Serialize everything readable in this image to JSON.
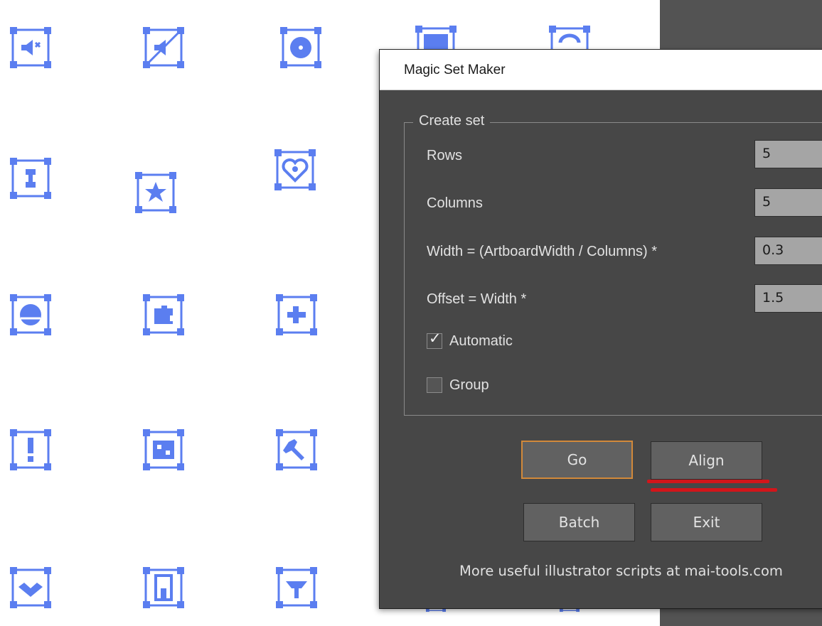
{
  "dialog": {
    "title": "Magic Set Maker",
    "group_title": "Create set",
    "fields": {
      "rows": {
        "label": "Rows",
        "value": "5"
      },
      "columns": {
        "label": "Columns",
        "value": "5"
      },
      "width": {
        "label": "Width = (ArtboardWidth / Columns) *",
        "value": "0.3"
      },
      "offset": {
        "label": "Offset = Width *",
        "value": "1.5"
      }
    },
    "checkboxes": {
      "automatic": {
        "label": "Automatic",
        "checked": true
      },
      "group": {
        "label": "Group",
        "checked": false
      }
    },
    "buttons": {
      "go": "Go",
      "align": "Align",
      "batch": "Batch",
      "exit": "Exit"
    },
    "footer": "More useful illustrator scripts at mai-tools.com"
  },
  "artboard": {
    "icon_color": "#5b7ef0",
    "icons": [
      "speaker-icon",
      "mute-icon",
      "disc-icon",
      "display-icon",
      "sync-icon",
      "gear-icon",
      "star-icon",
      "heart-icon",
      "globe-icon",
      "puzzle-icon",
      "medical-icon",
      "exclamation-icon",
      "network-icon",
      "wrench-icon",
      "handshake-icon",
      "building-icon",
      "tree-icon"
    ]
  },
  "colors": {
    "dialog_bg": "#474747",
    "accent_border": "#d2893a",
    "underline": "#d3151a"
  }
}
